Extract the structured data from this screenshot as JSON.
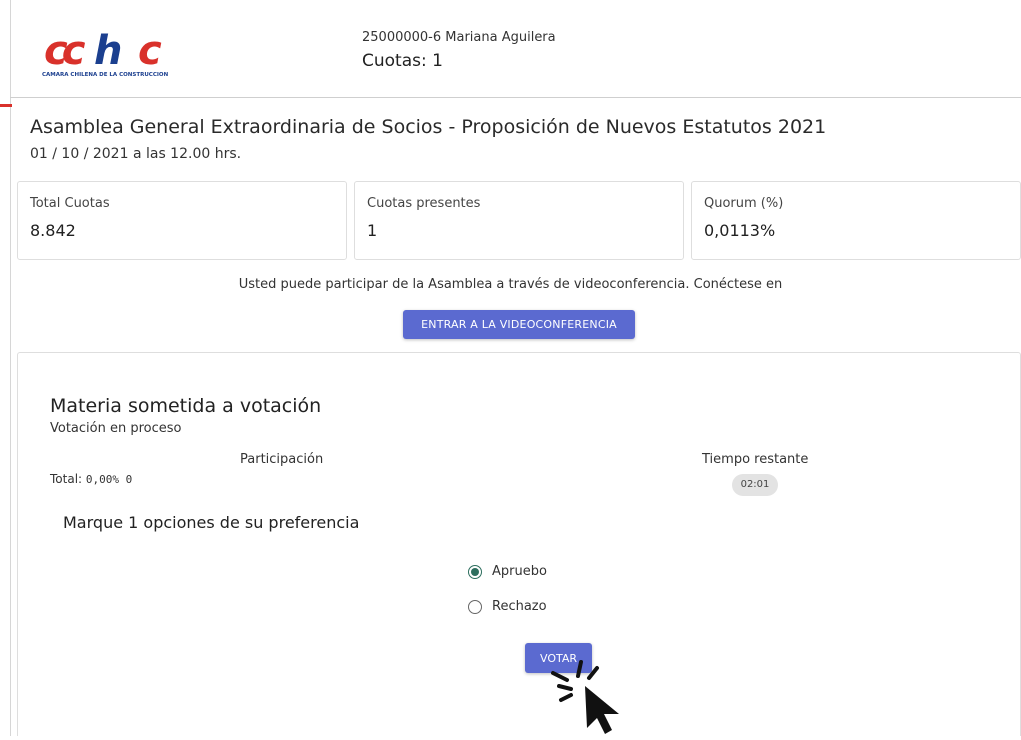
{
  "header": {
    "logo_text": "CCHC",
    "logo_subtitle": "CAMARA CHILENA DE LA CONSTRUCCION",
    "user": "25000000-6 Mariana Aguilera",
    "cuotas": "Cuotas: 1"
  },
  "event": {
    "title": "Asamblea General Extraordinaria de Socios - Proposición de Nuevos Estatutos 2021",
    "date": "01 / 10 / 2021 a las 12.00 hrs."
  },
  "stats": [
    {
      "label": "Total Cuotas",
      "value": "8.842"
    },
    {
      "label": "Cuotas presentes",
      "value": "1"
    },
    {
      "label": "Quorum (%)",
      "value": "0,0113%"
    }
  ],
  "video": {
    "text": "Usted puede participar de la Asamblea a través de videoconferencia. Conéctese en",
    "button": "ENTRAR A LA VIDEOCONFERENCIA"
  },
  "vote": {
    "title": "Materia sometida a votación",
    "status": "Votación en proceso",
    "participation_label": "Participación",
    "total_prefix": "Total:",
    "total_value": "0,00% 0",
    "time_label": "Tiempo restante",
    "time_value": "02:01",
    "instruction": "Marque 1 opciones de su preferencia",
    "options": [
      {
        "label": "Apruebo",
        "selected": true
      },
      {
        "label": "Rechazo",
        "selected": false
      }
    ],
    "submit": "VOTAR"
  },
  "colors": {
    "brand_red": "#d9312b",
    "brand_blue": "#1b3f8f",
    "button": "#5b6ad0",
    "radio_selected": "#2d6e5e"
  }
}
